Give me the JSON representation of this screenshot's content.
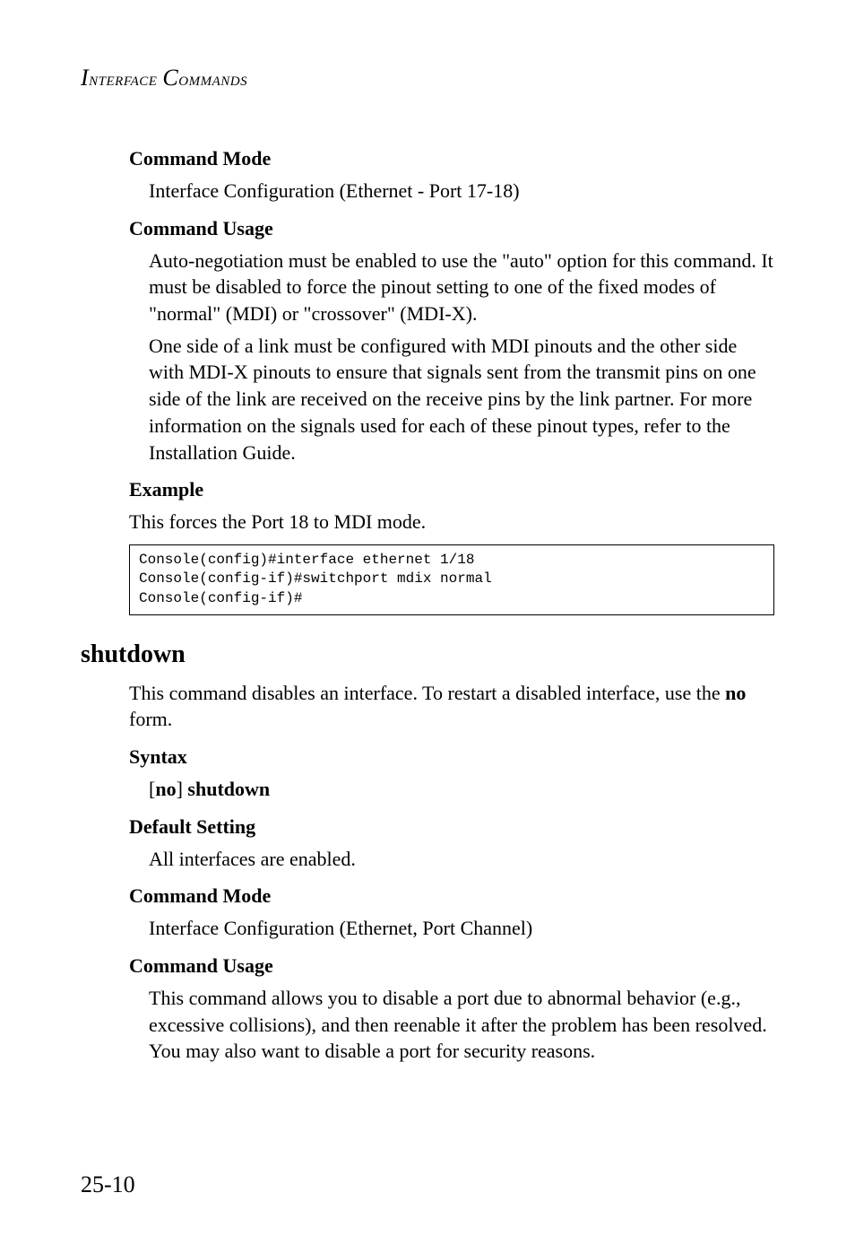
{
  "header": "Interface Commands",
  "s1": {
    "heading": "Command Mode",
    "body": "Interface Configuration (Ethernet - Port 17-18)"
  },
  "s2": {
    "heading": "Command Usage",
    "p1": "Auto-negotiation must be enabled to use the \"auto\" option for this command. It must be disabled to force the pinout setting to one of the fixed modes of \"normal\" (MDI) or \"crossover\" (MDI-X).",
    "p2": "One side of a link must be configured with MDI pinouts and the other side with MDI-X pinouts to ensure that signals sent from the transmit pins on one side of the link are received on the receive pins by the link partner. For more information on the signals used for each of these pinout types, refer to the Installation Guide."
  },
  "s3": {
    "heading": "Example",
    "body": "This forces the Port 18 to MDI mode."
  },
  "code": "Console(config)#interface ethernet 1/18\nConsole(config-if)#switchport mdix normal\nConsole(config-if)#",
  "section_heading": "shutdown",
  "s4": {
    "p1a": "This command disables an interface. To restart a disabled interface, use the ",
    "p1b": "no",
    "p1c": " form."
  },
  "s5": {
    "heading": "Syntax",
    "b1": "[",
    "b2": "no",
    "b3": "] ",
    "b4": "shutdown"
  },
  "s6": {
    "heading": "Default Setting",
    "body": "All interfaces are enabled."
  },
  "s7": {
    "heading": "Command Mode",
    "body": "Interface Configuration (Ethernet, Port Channel)"
  },
  "s8": {
    "heading": "Command Usage",
    "body": "This command allows you to disable a port due to abnormal behavior (e.g., excessive collisions), and then reenable it after the problem has been resolved. You may also want to disable a port for security reasons."
  },
  "page_number": "25-10"
}
